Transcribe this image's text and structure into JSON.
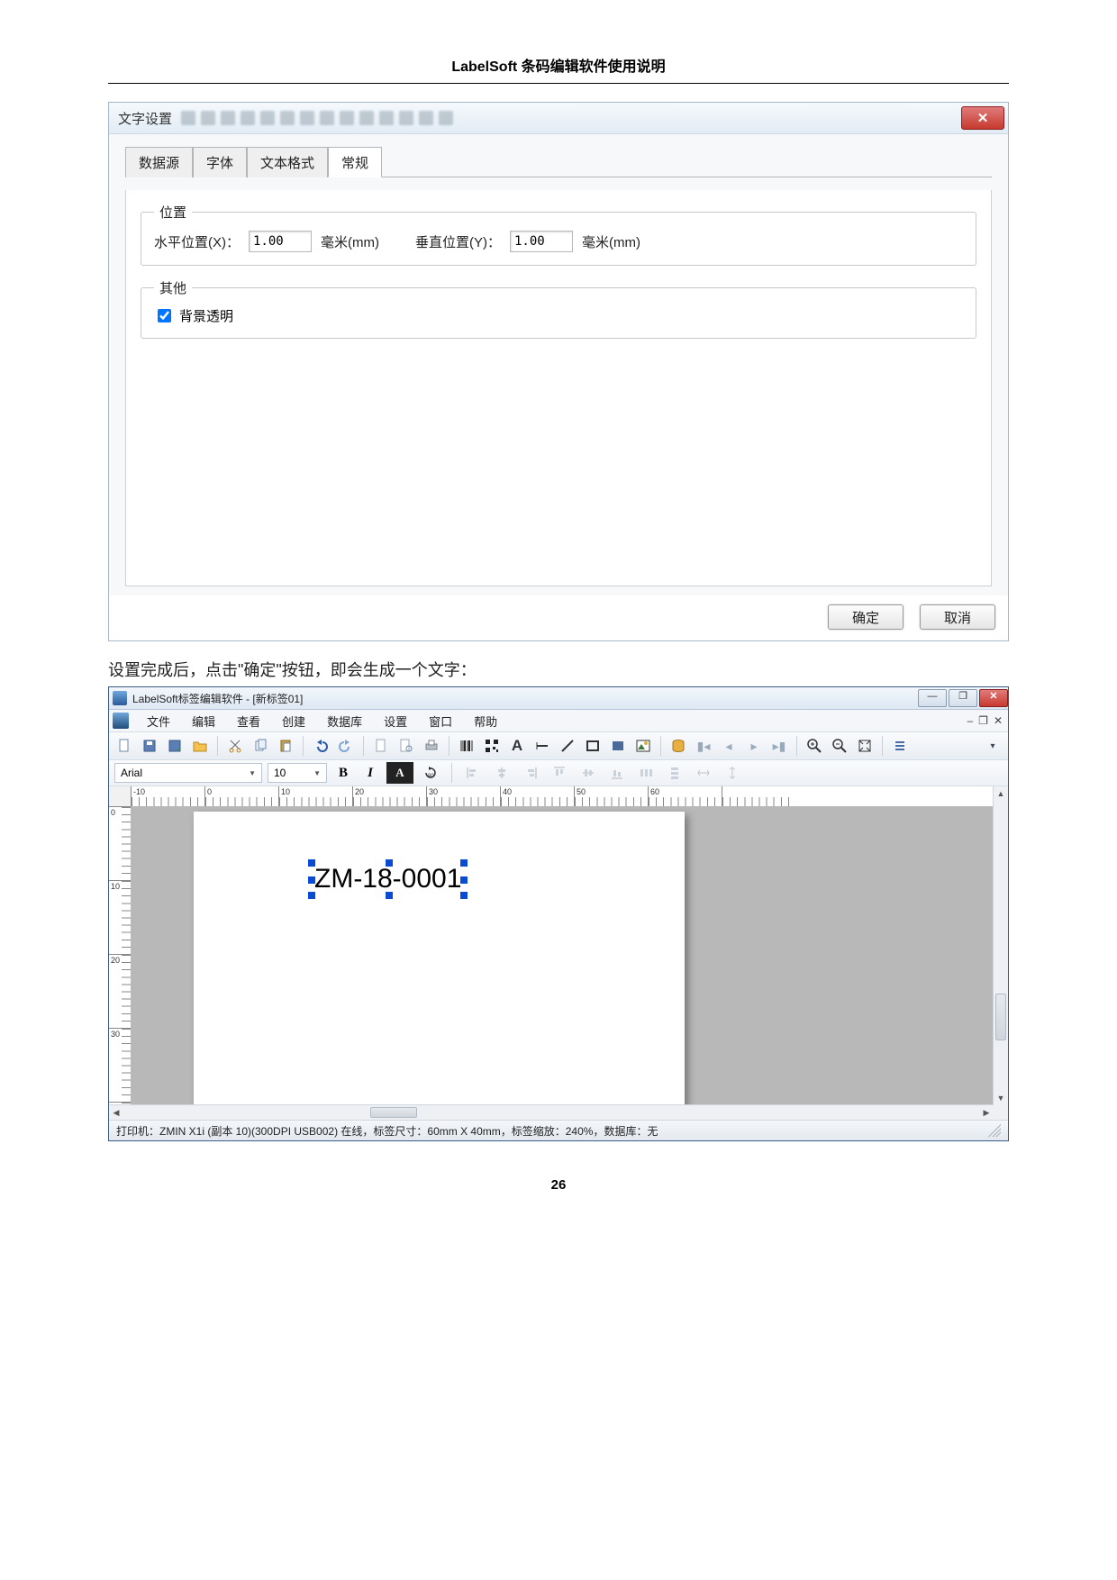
{
  "doc": {
    "header": "LabelSoft 条码编辑软件使用说明",
    "instruction": "设置完成后，点击\"确定\"按钮，即会生成一个文字：",
    "page_number": "26"
  },
  "dialog": {
    "title": "文字设置",
    "close": "✕",
    "tabs": [
      "数据源",
      "字体",
      "文本格式",
      "常规"
    ],
    "active_tab_index": 3,
    "position": {
      "legend": "位置",
      "x_label": "水平位置(X)：",
      "x_value": "1.00",
      "x_unit": "毫米(mm)",
      "y_label": "垂直位置(Y)：",
      "y_value": "1.00",
      "y_unit": "毫米(mm)"
    },
    "other": {
      "legend": "其他",
      "transparent_label": "背景透明",
      "transparent_checked": true
    },
    "ok": "确定",
    "cancel": "取消"
  },
  "app": {
    "title": "LabelSoft标签编辑软件 - [新标签01]",
    "menus": [
      "文件",
      "编辑",
      "查看",
      "创建",
      "数据库",
      "设置",
      "窗口",
      "帮助"
    ],
    "mdi_controls": [
      "–",
      "❐",
      "✕"
    ],
    "font_name": "Arial",
    "font_size": "10",
    "format_buttons": {
      "bold": "B",
      "italic": "I",
      "inverse": "A"
    },
    "ruler_h": [
      "-10",
      "0",
      "10",
      "20",
      "30",
      "40",
      "50",
      "60"
    ],
    "ruler_v": [
      "0",
      "10",
      "20",
      "30"
    ],
    "label_text": "ZM-18-0001",
    "status": "打印机：ZMIN X1i (副本 10)(300DPI USB002) 在线，标签尺寸：60mm X 40mm，标签缩放：240%，数据库：无"
  }
}
